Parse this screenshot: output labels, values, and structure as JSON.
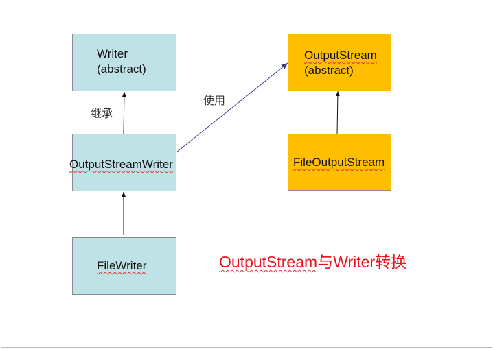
{
  "boxes": {
    "writer": {
      "line1": "Writer",
      "line2": "(abstract)"
    },
    "output_stream": {
      "line1": "OutputStream",
      "line2": "(abstract)"
    },
    "output_stream_writer": {
      "label": "OutputStreamWriter"
    },
    "file_output_stream": {
      "label": "FileOutputStream"
    },
    "file_writer": {
      "label": "FileWriter"
    }
  },
  "labels": {
    "inherit": "继承",
    "use": "使用"
  },
  "caption": {
    "part1": "OutputStream",
    "part2": "与",
    "part3": "Writer",
    "part4": "转换"
  },
  "colors": {
    "box_blue": "#bfe2e6",
    "box_orange": "#ffbf00",
    "use_arrow": "#3a3a8c",
    "caption": "#e8121b"
  }
}
